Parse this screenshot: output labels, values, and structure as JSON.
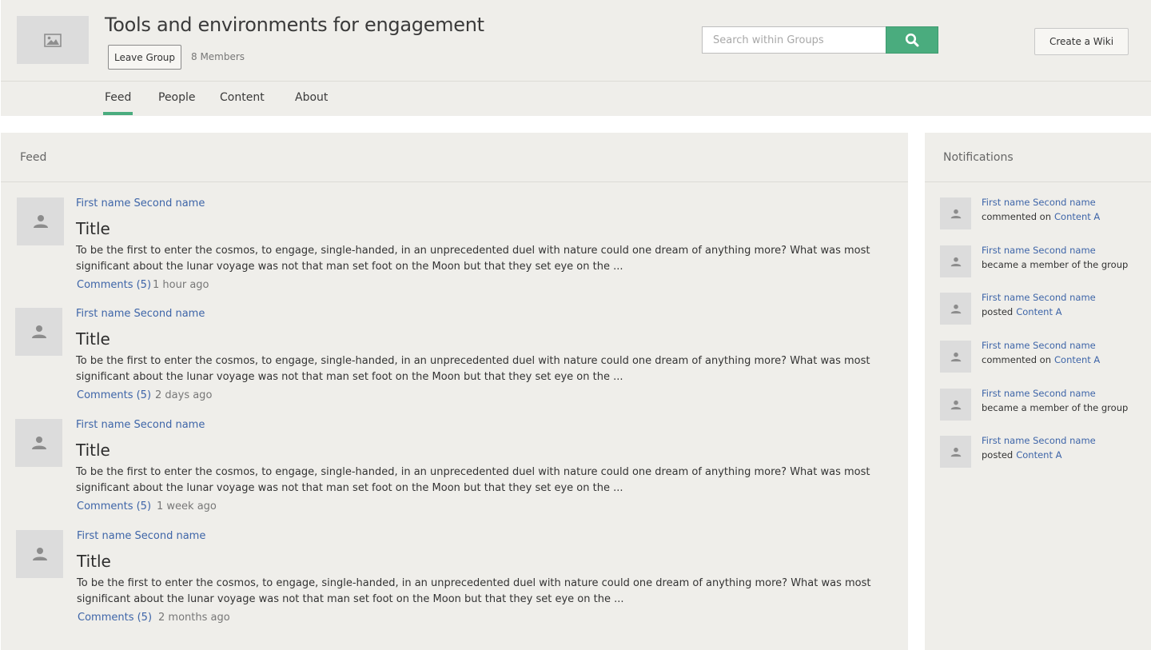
{
  "group": {
    "title": "Tools and environments for engagement",
    "leave_label": "Leave Group",
    "members": "8 Members",
    "image_icon": "image-placeholder-icon"
  },
  "search": {
    "placeholder": "Search within Groups",
    "icon": "search-icon"
  },
  "create_wiki_label": "Create a Wiki",
  "tabs": [
    {
      "label": "Feed",
      "active": true
    },
    {
      "label": "People"
    },
    {
      "label": "Content"
    },
    {
      "label": "About"
    }
  ],
  "feed": {
    "heading": "Feed",
    "posts": [
      {
        "author": "First name Second name",
        "title": "Title",
        "body": "To be the first to enter the cosmos, to engage, single-handed, in an unprecedented duel with nature could one dream of anything more? What was most significant about the lunar voyage was not that man set foot on the Moon but that they set eye on the ...",
        "comments": "Comments (5)",
        "time": "1 hour ago"
      },
      {
        "author": "First name Second name",
        "title": "Title",
        "body": "To be the first to enter the cosmos, to engage, single-handed, in an unprecedented duel with nature could one dream of anything more? What was most significant about the lunar voyage was not that man set foot on the Moon but that they set eye on the ...",
        "comments": "Comments (5)",
        "time": "2 days ago"
      },
      {
        "author": "First name Second name",
        "title": "Title",
        "body": "To be the first to enter the cosmos, to engage, single-handed, in an unprecedented duel with nature could one dream of anything more? What was most significant about the lunar voyage was not that man set foot on the Moon but that they set eye on the ...",
        "comments": "Comments (5)",
        "time": "1 week ago"
      },
      {
        "author": "First name Second name",
        "title": "Title",
        "body": "To be the first to enter the cosmos, to engage, single-handed, in an unprecedented duel with nature could one dream of anything more? What was most significant about the lunar voyage was not that man set foot on the Moon but that they set eye on the ...",
        "comments": "Comments (5)",
        "time": "2 months ago"
      }
    ]
  },
  "notifications": {
    "heading": "Notifications",
    "items": [
      {
        "name": "First name Second name",
        "action": "commented on",
        "link": "Content A"
      },
      {
        "name": "First name Second name",
        "action": "became a member of the group",
        "link": ""
      },
      {
        "name": "First name Second name",
        "action": "posted",
        "link": "Content A"
      },
      {
        "name": "First name Second name",
        "action": "commented on",
        "link": "Content A"
      },
      {
        "name": "First name Second name",
        "action": "became a member of the group",
        "link": ""
      },
      {
        "name": "First name Second name",
        "action": "posted",
        "link": "Content A"
      }
    ]
  },
  "colors": {
    "accent": "#4aac7e",
    "link": "#3e65a8",
    "panel_bg": "#efeeea"
  }
}
